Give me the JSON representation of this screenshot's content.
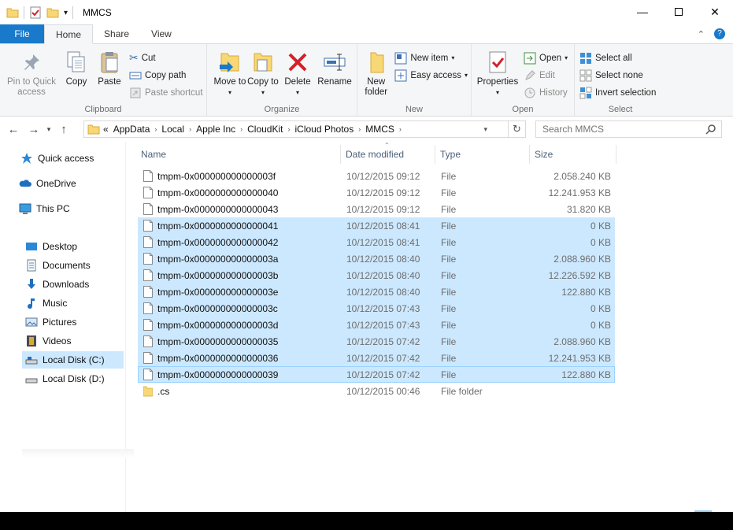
{
  "window": {
    "title": "MMCS",
    "controls": [
      "minimize-icon",
      "maximize-icon",
      "close-icon"
    ]
  },
  "ribbon_tabs": [
    "File",
    "Home",
    "Share",
    "View"
  ],
  "ribbon": {
    "clipboard": {
      "label": "Clipboard",
      "pin": "Pin to Quick access",
      "copy": "Copy",
      "paste": "Paste",
      "cut": "Cut",
      "copy_path": "Copy path",
      "paste_shortcut": "Paste shortcut"
    },
    "organize": {
      "label": "Organize",
      "move_to": "Move to",
      "copy_to": "Copy to",
      "delete": "Delete",
      "rename": "Rename"
    },
    "new": {
      "label": "New",
      "new_folder": "New folder",
      "new_item": "New item",
      "easy_access": "Easy access"
    },
    "open": {
      "label": "Open",
      "properties": "Properties",
      "open": "Open",
      "edit": "Edit",
      "history": "History"
    },
    "select": {
      "label": "Select",
      "select_all": "Select all",
      "select_none": "Select none",
      "invert_selection": "Invert selection"
    }
  },
  "address": {
    "overflow": "«",
    "crumbs": [
      "AppData",
      "Local",
      "Apple Inc",
      "CloudKit",
      "iCloud Photos",
      "MMCS"
    ]
  },
  "search": {
    "placeholder": "Search MMCS"
  },
  "navpane": {
    "items": [
      {
        "label": "Quick access",
        "icon": "star-icon"
      },
      {
        "label": "OneDrive",
        "icon": "cloud-icon"
      },
      {
        "label": "This PC",
        "icon": "monitor-icon"
      },
      {
        "label": "Desktop",
        "icon": "desktop-icon"
      },
      {
        "label": "Documents",
        "icon": "documents-icon"
      },
      {
        "label": "Downloads",
        "icon": "download-arrow-icon"
      },
      {
        "label": "Music",
        "icon": "music-note-icon"
      },
      {
        "label": "Pictures",
        "icon": "pictures-icon"
      },
      {
        "label": "Videos",
        "icon": "videos-icon"
      },
      {
        "label": "Local Disk (C:)",
        "icon": "drive-icon"
      },
      {
        "label": "Local Disk (D:)",
        "icon": "drive-icon"
      }
    ]
  },
  "columns": {
    "name": "Name",
    "date": "Date modified",
    "type": "Type",
    "size": "Size"
  },
  "files": [
    {
      "name": "tmpm-0x000000000000003f",
      "date": "10/12/2015 09:12",
      "type": "File",
      "size": "2.058.240 KB",
      "selected": false
    },
    {
      "name": "tmpm-0x0000000000000040",
      "date": "10/12/2015 09:12",
      "type": "File",
      "size": "12.241.953 KB",
      "selected": false
    },
    {
      "name": "tmpm-0x0000000000000043",
      "date": "10/12/2015 09:12",
      "type": "File",
      "size": "31.820 KB",
      "selected": false
    },
    {
      "name": "tmpm-0x0000000000000041",
      "date": "10/12/2015 08:41",
      "type": "File",
      "size": "0 KB",
      "selected": true
    },
    {
      "name": "tmpm-0x0000000000000042",
      "date": "10/12/2015 08:41",
      "type": "File",
      "size": "0 KB",
      "selected": true
    },
    {
      "name": "tmpm-0x000000000000003a",
      "date": "10/12/2015 08:40",
      "type": "File",
      "size": "2.088.960 KB",
      "selected": true
    },
    {
      "name": "tmpm-0x000000000000003b",
      "date": "10/12/2015 08:40",
      "type": "File",
      "size": "12.226.592 KB",
      "selected": true
    },
    {
      "name": "tmpm-0x000000000000003e",
      "date": "10/12/2015 08:40",
      "type": "File",
      "size": "122.880 KB",
      "selected": true
    },
    {
      "name": "tmpm-0x000000000000003c",
      "date": "10/12/2015 07:43",
      "type": "File",
      "size": "0 KB",
      "selected": true
    },
    {
      "name": "tmpm-0x000000000000003d",
      "date": "10/12/2015 07:43",
      "type": "File",
      "size": "0 KB",
      "selected": true
    },
    {
      "name": "tmpm-0x0000000000000035",
      "date": "10/12/2015 07:42",
      "type": "File",
      "size": "2.088.960 KB",
      "selected": true
    },
    {
      "name": "tmpm-0x0000000000000036",
      "date": "10/12/2015 07:42",
      "type": "File",
      "size": "12.241.953 KB",
      "selected": true
    },
    {
      "name": "tmpm-0x0000000000000039",
      "date": "10/12/2015 07:42",
      "type": "File",
      "size": "122.880 KB",
      "selected": true,
      "focused": true
    },
    {
      "name": ".cs",
      "date": "10/12/2015 00:46",
      "type": "File folder",
      "size": "",
      "selected": false,
      "folder": true
    }
  ],
  "colors": {
    "accent": "#1979ca",
    "selection": "#cce8ff",
    "folder": "#f8d775",
    "delete_red": "#d4202a"
  }
}
